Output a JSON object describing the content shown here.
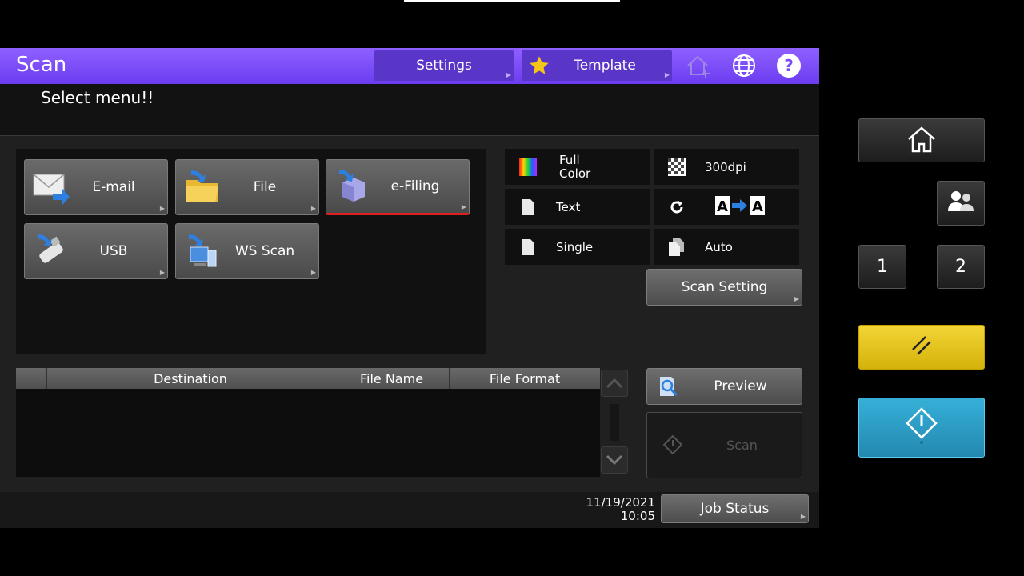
{
  "app": {
    "title": "Scan"
  },
  "header": {
    "settings_label": "Settings",
    "template_label": "Template",
    "icons": [
      "home-add-icon",
      "globe-icon",
      "help-icon"
    ]
  },
  "message": "Select menu!!",
  "menu": {
    "items": [
      {
        "label": "E-mail",
        "icon": "email-icon"
      },
      {
        "label": "File",
        "icon": "folder-icon"
      },
      {
        "label": "e-Filing",
        "icon": "efiling-box-icon",
        "selected": true
      },
      {
        "label": "USB",
        "icon": "usb-icon"
      },
      {
        "label": "WS Scan",
        "icon": "ws-scan-icon"
      }
    ]
  },
  "options": {
    "color": "Full\nColor",
    "resolution": "300dpi",
    "mode": "Text",
    "rotation_icon": "rotate-icon",
    "sides": "Single",
    "size": "Auto"
  },
  "buttons": {
    "scan_setting": "Scan Setting",
    "preview": "Preview",
    "scan": "Scan",
    "job_status": "Job Status"
  },
  "table": {
    "columns": [
      "Destination",
      "File Name",
      "File Format"
    ]
  },
  "datetime": {
    "date": "11/19/2021",
    "time": "10:05"
  },
  "hardware": {
    "one": "1",
    "two": "2",
    "reset_color": "#e8c414",
    "start_color": "#2c9fc6"
  },
  "colors": {
    "header": "#7a4cf7",
    "selected_border": "#e02020"
  }
}
